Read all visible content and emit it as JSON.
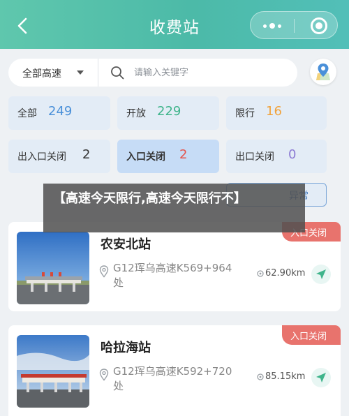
{
  "header": {
    "title": "收费站"
  },
  "search": {
    "type_label": "全部高速",
    "placeholder": "请输入关键字"
  },
  "filters": [
    {
      "label": "全部",
      "count": "249",
      "color": "#4a90d9"
    },
    {
      "label": "开放",
      "count": "229",
      "color": "#3fb48b"
    },
    {
      "label": "限行",
      "count": "16",
      "color": "#f1a23a"
    },
    {
      "label": "出入口关闭",
      "count": "2",
      "color": "#333333"
    },
    {
      "label": "入口关闭",
      "count": "2",
      "color": "#e5534b"
    },
    {
      "label": "出口关闭",
      "count": "0",
      "color": "#8b7ad3"
    }
  ],
  "abnormal_filter": {
    "label": "异常"
  },
  "overlay": {
    "text": "【高速今天限行,高速今天限行不】"
  },
  "stations": [
    {
      "name": "农安北站",
      "location": "G12珲乌高速K569+964处",
      "distance": "62.90km",
      "status": "入口关闭"
    },
    {
      "name": "哈拉海站",
      "location": "G12珲乌高速K592+720处",
      "distance": "85.15km",
      "status": "入口关闭"
    }
  ],
  "colors": {
    "header_accent": "#4cbaa8",
    "status_tag": "#e8736d",
    "active_filter_bg": "#c6dcf6"
  },
  "icons": {
    "back": "chevron-left-icon",
    "more": "more-dots-icon",
    "close": "target-close-icon",
    "search": "search-icon",
    "map": "map-pin-icon",
    "location": "location-pin-icon",
    "distance": "distance-icon",
    "navigate": "navigate-arrow-icon"
  }
}
